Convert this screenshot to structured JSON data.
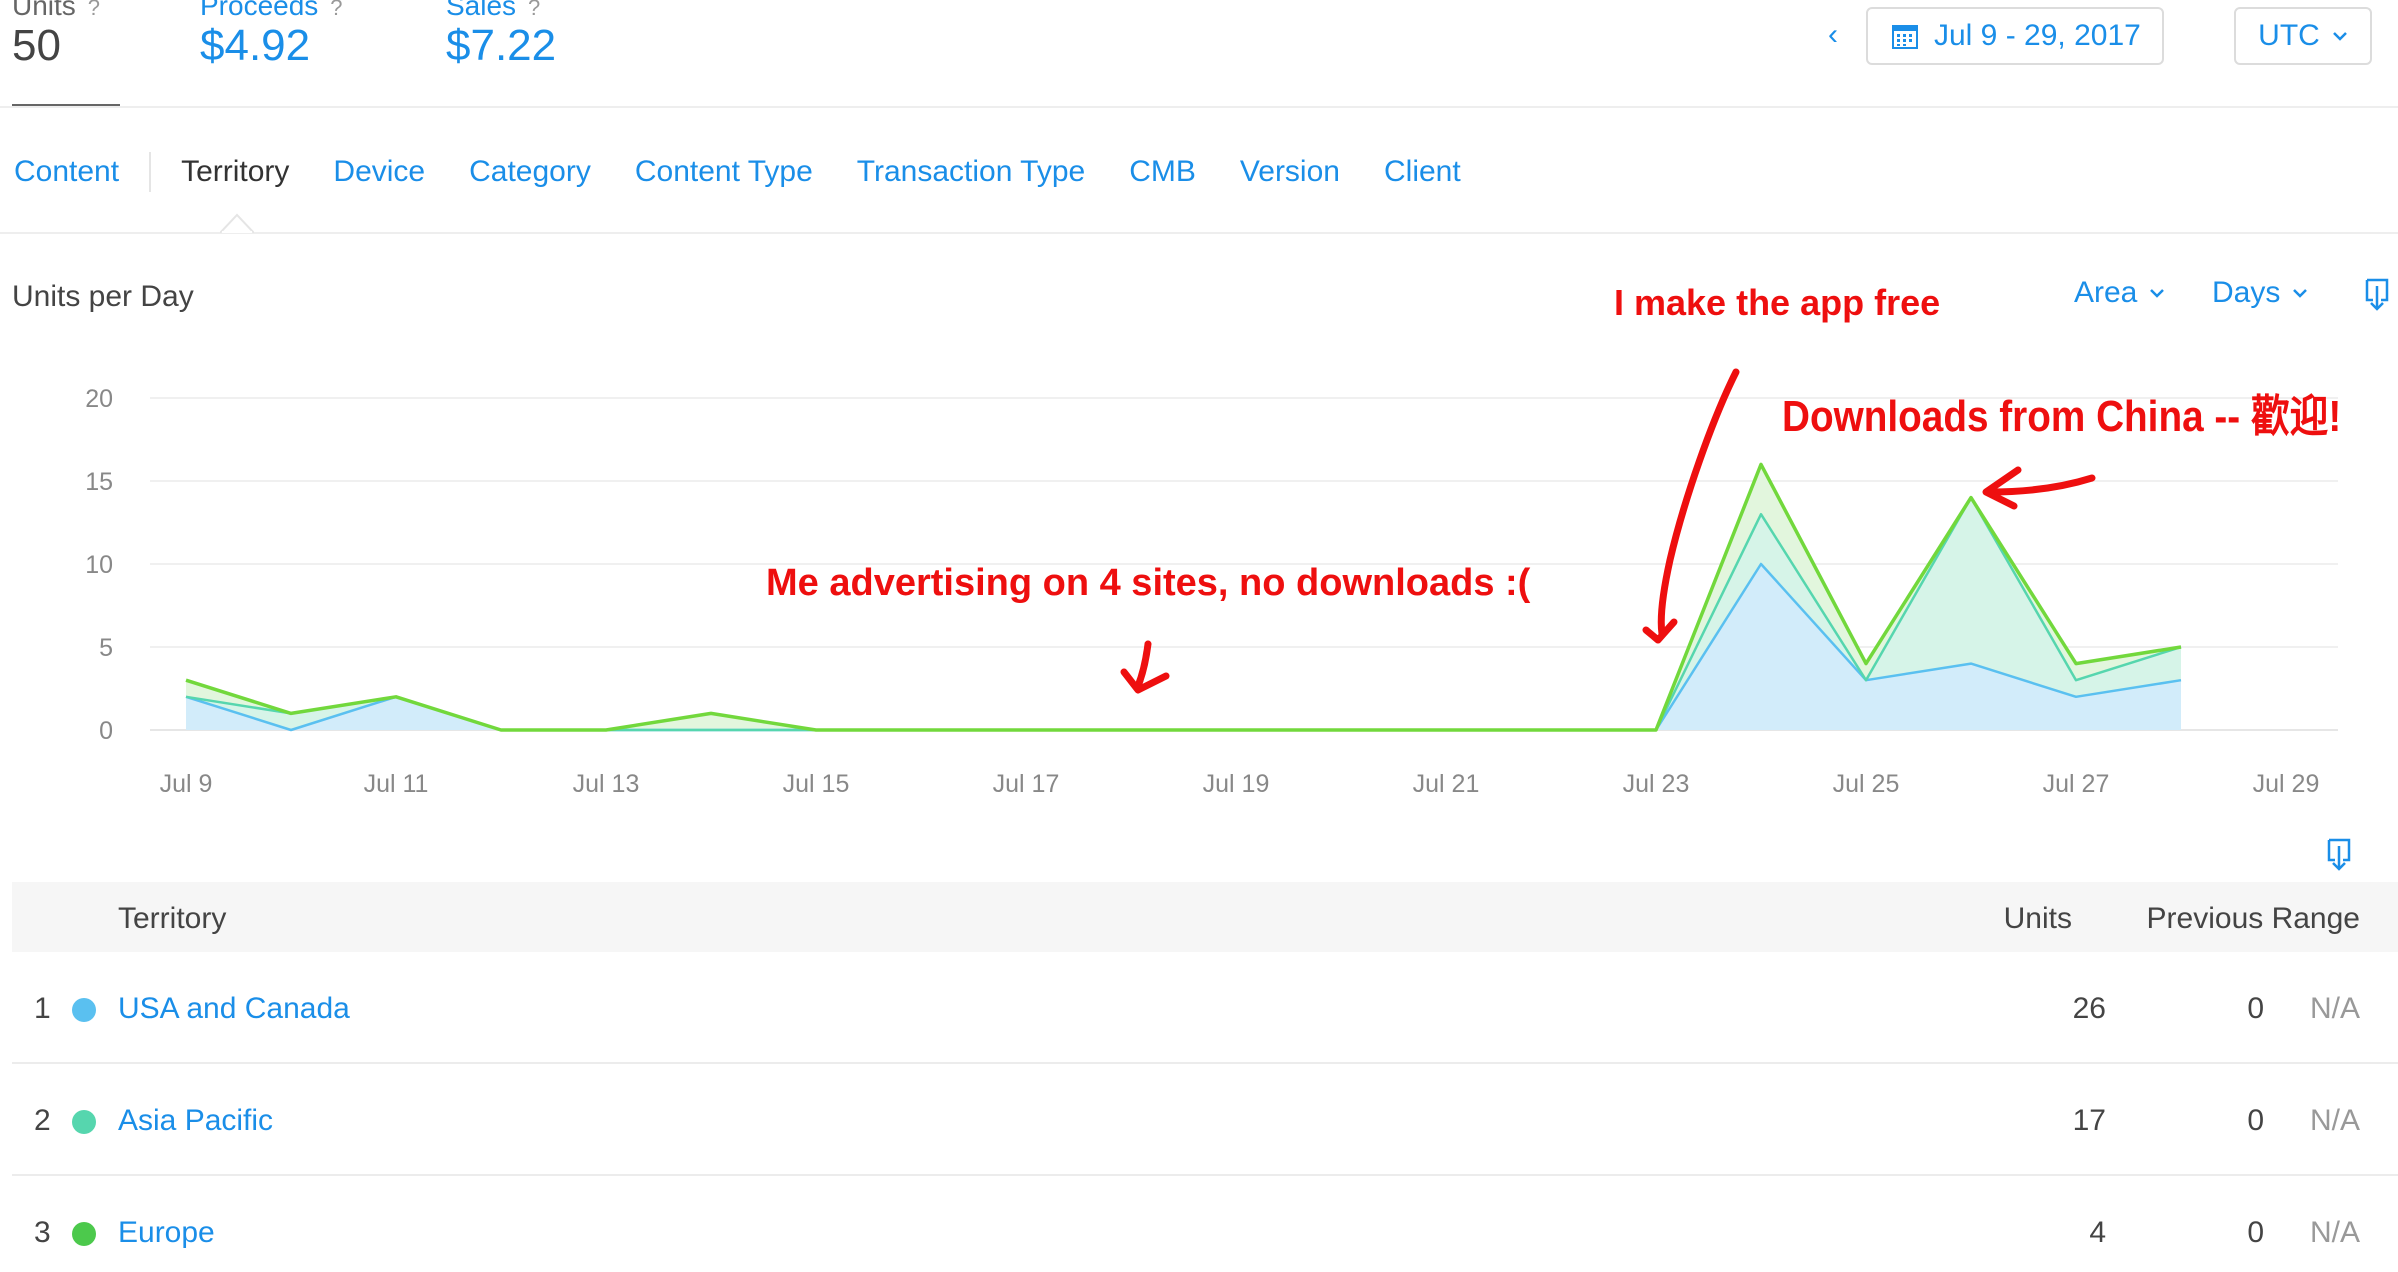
{
  "header": {
    "metrics": [
      {
        "label": "Units",
        "help": "?",
        "value": "50"
      },
      {
        "label": "Proceeds",
        "help": "?",
        "value": "$4.92"
      },
      {
        "label": "Sales",
        "help": "?",
        "value": "$7.22"
      }
    ],
    "date_prev": "‹",
    "date_range": "Jul 9 - 29, 2017",
    "timezone": "UTC"
  },
  "tabs": [
    {
      "label": "Content",
      "active": false
    },
    {
      "label": "Territory",
      "active": true
    },
    {
      "label": "Device",
      "active": false
    },
    {
      "label": "Category",
      "active": false
    },
    {
      "label": "Content Type",
      "active": false
    },
    {
      "label": "Transaction Type",
      "active": false
    },
    {
      "label": "CMB",
      "active": false
    },
    {
      "label": "Version",
      "active": false
    },
    {
      "label": "Client",
      "active": false
    }
  ],
  "chart_panel": {
    "title": "Units per Day",
    "chart_type_control": "Area",
    "interval_control": "Days"
  },
  "annotations": {
    "free": "I make the app free",
    "china": "Downloads from China -- 歡迎!",
    "ads": "Me advertising on 4 sites, no downloads :("
  },
  "colors": {
    "accent": "#1a8ee8",
    "usa": "#5ac0f0",
    "asia": "#56d6ae",
    "europe": "#4cc94c",
    "annotation": "#ee0f0f"
  },
  "chart_data": {
    "type": "area",
    "stacked": true,
    "x": [
      "Jul 9",
      "Jul 10",
      "Jul 11",
      "Jul 12",
      "Jul 13",
      "Jul 14",
      "Jul 15",
      "Jul 16",
      "Jul 17",
      "Jul 18",
      "Jul 19",
      "Jul 20",
      "Jul 21",
      "Jul 22",
      "Jul 23",
      "Jul 24",
      "Jul 25",
      "Jul 26",
      "Jul 27",
      "Jul 28"
    ],
    "x_tick_labels": [
      "Jul 9",
      "Jul 11",
      "Jul 13",
      "Jul 15",
      "Jul 17",
      "Jul 19",
      "Jul 21",
      "Jul 23",
      "Jul 25",
      "Jul 27",
      "Jul 29"
    ],
    "xlim": [
      "Jul 9",
      "Jul 29"
    ],
    "ylim": [
      0,
      20
    ],
    "y_ticks": [
      0,
      5,
      10,
      15,
      20
    ],
    "grid": true,
    "series": [
      {
        "name": "USA and Canada",
        "color": "#5ac0f0",
        "values": [
          2,
          0,
          2,
          0,
          0,
          0,
          0,
          0,
          0,
          0,
          0,
          0,
          0,
          0,
          0,
          10,
          3,
          4,
          2,
          3
        ]
      },
      {
        "name": "Asia Pacific",
        "color": "#56d6ae",
        "values": [
          0,
          1,
          0,
          0,
          0,
          0,
          0,
          0,
          0,
          0,
          0,
          0,
          0,
          0,
          0,
          3,
          0,
          10,
          1,
          2
        ]
      },
      {
        "name": "Europe",
        "color": "#4cc94c",
        "values": [
          1,
          0,
          0,
          0,
          0,
          1,
          0,
          0,
          0,
          0,
          0,
          0,
          0,
          0,
          0,
          3,
          1,
          0,
          1,
          0
        ]
      }
    ]
  },
  "table": {
    "headers": {
      "territory": "Territory",
      "units": "Units",
      "previous": "Previous Range"
    },
    "rows": [
      {
        "rank": "1",
        "name": "USA and Canada",
        "units": "26",
        "previous": "0",
        "change": "N/A",
        "color": "#5ac0f0"
      },
      {
        "rank": "2",
        "name": "Asia Pacific",
        "units": "17",
        "previous": "0",
        "change": "N/A",
        "color": "#56d6ae"
      },
      {
        "rank": "3",
        "name": "Europe",
        "units": "4",
        "previous": "0",
        "change": "N/A",
        "color": "#4cc94c"
      }
    ]
  }
}
